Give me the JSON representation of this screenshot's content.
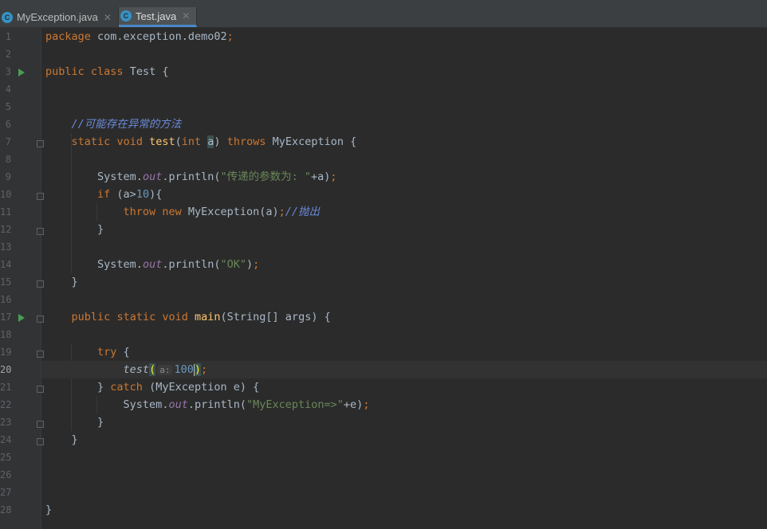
{
  "tabs": [
    {
      "name": "MyException.java",
      "icon": "C",
      "active": false
    },
    {
      "name": "Test.java",
      "icon": "C",
      "active": true
    }
  ],
  "close_glyph": "✕",
  "line_numbers": [
    "1",
    "2",
    "3",
    "4",
    "5",
    "6",
    "7",
    "8",
    "9",
    "10",
    "11",
    "12",
    "13",
    "14",
    "15",
    "16",
    "17",
    "18",
    "19",
    "20",
    "21",
    "22",
    "23",
    "24",
    "25",
    "26",
    "27",
    "28"
  ],
  "code": {
    "l1": {
      "kw": "package",
      "rest": " com.exception.demo02",
      "semi": ";"
    },
    "l3": {
      "kw1": "public",
      "kw2": "class",
      "name": " Test {"
    },
    "l6": {
      "comment": "//可能存在异常的方法"
    },
    "l7": {
      "kw1": "static",
      "kw2": "void",
      "fn": "test",
      "open": "(",
      "type": "int",
      "param": "a",
      "close": ")",
      "throws": "throws",
      "rest": " MyException {"
    },
    "l9": {
      "obj": "System.",
      "fld": "out",
      "call": ".println(",
      "str": "\"传递的参数为: \"",
      "rest": "+a)",
      "semi": ";"
    },
    "l10": {
      "kw": "if",
      "pre": " (a>",
      "num": "10",
      "post": "){"
    },
    "l11": {
      "kw1": "throw",
      "kw2": "new",
      "rest": " MyException(a)",
      "semi": ";",
      "comment": "//抛出"
    },
    "l12": {
      "text": "}"
    },
    "l14": {
      "obj": "System.",
      "fld": "out",
      "call": ".println(",
      "str": "\"OK\"",
      "rest": ")",
      "semi": ";"
    },
    "l15": {
      "text": "}"
    },
    "l17": {
      "kw1": "public",
      "kw2": "static",
      "kw3": "void",
      "fn": "main",
      "rest": "(String[] args) {"
    },
    "l19": {
      "kw": "try",
      "rest": " {"
    },
    "l20": {
      "fn": "test",
      "open": "(",
      "hint": "a:",
      "num": "100",
      "close": ")",
      "semi": ";"
    },
    "l21": {
      "pre": "} ",
      "kw": "catch",
      "rest": " (MyException e) {"
    },
    "l22": {
      "obj": "System.",
      "fld": "out",
      "call": ".println(",
      "str": "\"MyException=>\"",
      "rest": "+e)",
      "semi": ";"
    },
    "l23": {
      "text": "}"
    },
    "l24": {
      "text": "}"
    },
    "l28": {
      "text": "}"
    }
  },
  "colors": {
    "background": "#2b2b2b",
    "keyword": "#cc7832",
    "function": "#ffc66d",
    "string": "#6a8759",
    "number": "#6897bb",
    "field": "#9876aa",
    "comment": "#6a8ad9"
  },
  "current_line": "20"
}
